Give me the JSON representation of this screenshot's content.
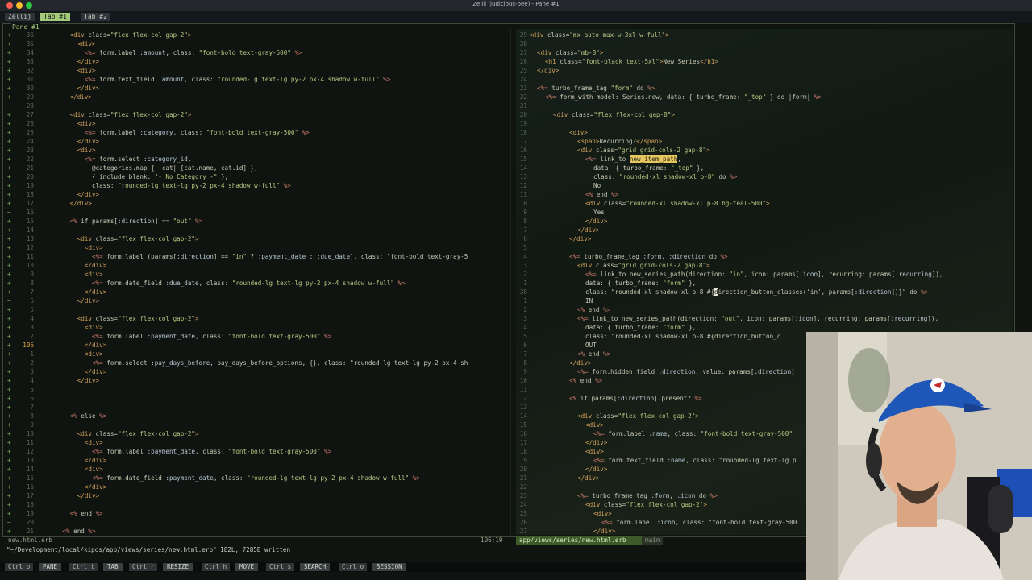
{
  "window": {
    "title": "Zellij (judicious-bee) - Pane #1"
  },
  "tabs": {
    "app": "Zellij",
    "tab1": "Tab #1",
    "tab2": "Tab #2"
  },
  "pane": {
    "title": "Pane #1"
  },
  "left": {
    "gutter_marks": [
      "+",
      "+",
      "+",
      "+",
      "+",
      "+",
      "+",
      "+",
      "~",
      "+",
      "+",
      "+",
      "+",
      "+",
      "+",
      "+",
      "+",
      "+",
      "+",
      "+",
      "~",
      "+",
      "+",
      "+",
      "+",
      "+",
      "+",
      "+",
      "+",
      "+",
      "~",
      "+",
      "+",
      "+",
      "+",
      "+",
      "+",
      "+",
      "+",
      "+",
      "+",
      "+",
      "+",
      "+",
      "+",
      "+",
      "+",
      "+",
      "+",
      "+",
      "+",
      "+",
      "+",
      "+",
      "+",
      "~",
      "+"
    ],
    "line_numbers": [
      "36",
      "35",
      "34",
      "33",
      "32",
      "31",
      "30",
      "29",
      "28",
      "27",
      "26",
      "25",
      "24",
      "23",
      "22",
      "21",
      "20",
      "19",
      "18",
      "17",
      "16",
      "15",
      "14",
      "13",
      "12",
      "11",
      "10",
      "9",
      "8",
      "7",
      "6",
      "5",
      "4",
      "3",
      "2",
      "106",
      "1",
      "2",
      "3",
      "4",
      "5",
      "6",
      "7",
      "8",
      "9",
      "10",
      "11",
      "12",
      "13",
      "14",
      "15",
      "16",
      "17",
      "18",
      "19",
      "20",
      "21"
    ],
    "lines": [
      {
        "indent": 8,
        "text": "<div class=\"flex flex-col gap-2\">"
      },
      {
        "indent": 10,
        "text": "<div>"
      },
      {
        "indent": 12,
        "text": "<%= form.label :amount, class: \"font-bold text-gray-500\" %>"
      },
      {
        "indent": 10,
        "text": "</div>"
      },
      {
        "indent": 10,
        "text": "<div>"
      },
      {
        "indent": 12,
        "text": "<%= form.text_field :amount, class: \"rounded-lg text-lg py-2 px-4 shadow w-full\" %>"
      },
      {
        "indent": 10,
        "text": "</div>"
      },
      {
        "indent": 8,
        "text": "</div>"
      },
      {
        "indent": 0,
        "text": ""
      },
      {
        "indent": 8,
        "text": "<div class=\"flex flex-col gap-2\">"
      },
      {
        "indent": 10,
        "text": "<div>"
      },
      {
        "indent": 12,
        "text": "<%= form.label :category, class: \"font-bold text-gray-500\" %>"
      },
      {
        "indent": 10,
        "text": "</div>"
      },
      {
        "indent": 10,
        "text": "<div>"
      },
      {
        "indent": 12,
        "text": "<%= form.select :category_id,"
      },
      {
        "indent": 14,
        "text": "@categories.map { |cat| [cat.name, cat.id] },"
      },
      {
        "indent": 14,
        "text": "{ include_blank: \"- No Category -\" },"
      },
      {
        "indent": 14,
        "text": "class: \"rounded-lg text-lg py-2 px-4 shadow w-full\" %>"
      },
      {
        "indent": 10,
        "text": "</div>"
      },
      {
        "indent": 8,
        "text": "</div>"
      },
      {
        "indent": 0,
        "text": ""
      },
      {
        "indent": 8,
        "text": "<% if params[:direction] == \"out\" %>"
      },
      {
        "indent": 0,
        "text": ""
      },
      {
        "indent": 10,
        "text": "<div class=\"flex flex-col gap-2\">"
      },
      {
        "indent": 12,
        "text": "<div>"
      },
      {
        "indent": 14,
        "text": "<%= form.label (params[:direction] == \"in\" ? :payment_date : :due_date), class: \"font-bold text-gray-5"
      },
      {
        "indent": 12,
        "text": "</div>"
      },
      {
        "indent": 12,
        "text": "<div>"
      },
      {
        "indent": 14,
        "text": "<%= form.date_field :due_date, class: \"rounded-lg text-lg py-2 px-4 shadow w-full\" %>"
      },
      {
        "indent": 12,
        "text": "</div>"
      },
      {
        "indent": 10,
        "text": "</div>"
      },
      {
        "indent": 0,
        "text": ""
      },
      {
        "indent": 10,
        "text": "<div class=\"flex flex-col gap-2\">"
      },
      {
        "indent": 12,
        "text": "<div>"
      },
      {
        "indent": 14,
        "text": "<%= form.label :payment_date, class: \"font-bold text-gray-500\" %>"
      },
      {
        "indent": 12,
        "text": "</div>"
      },
      {
        "indent": 12,
        "text": "<div>"
      },
      {
        "indent": 14,
        "text": "<%= form.select :pay_days_before, pay_days_before_options, {}, class: \"rounded-lg text-lg py-2 px-4 sh"
      },
      {
        "indent": 12,
        "text": "</div>"
      },
      {
        "indent": 10,
        "text": "</div>"
      },
      {
        "indent": 0,
        "text": ""
      },
      {
        "indent": 0,
        "text": ""
      },
      {
        "indent": 0,
        "text": ""
      },
      {
        "indent": 8,
        "text": "<% else %>"
      },
      {
        "indent": 0,
        "text": ""
      },
      {
        "indent": 10,
        "text": "<div class=\"flex flex-col gap-2\">"
      },
      {
        "indent": 12,
        "text": "<div>"
      },
      {
        "indent": 14,
        "text": "<%= form.label :payment_date, class: \"font-bold text-gray-500\" %>"
      },
      {
        "indent": 12,
        "text": "</div>"
      },
      {
        "indent": 12,
        "text": "<div>"
      },
      {
        "indent": 14,
        "text": "<%= form.date_field :payment_date, class: \"rounded-lg text-lg py-2 px-4 shadow w-full\" %>"
      },
      {
        "indent": 12,
        "text": "</div>"
      },
      {
        "indent": 10,
        "text": "</div>"
      },
      {
        "indent": 0,
        "text": ""
      },
      {
        "indent": 8,
        "text": "<% end %>"
      },
      {
        "indent": 0,
        "text": ""
      },
      {
        "indent": 6,
        "text": "<% end %>"
      }
    ]
  },
  "right": {
    "line_numbers": [
      "29",
      "28",
      "27",
      "26",
      "25",
      "24",
      "23",
      "22",
      "21",
      "20",
      "19",
      "18",
      "17",
      "16",
      "15",
      "14",
      "13",
      "12",
      "11",
      "10",
      "9",
      "8",
      "7",
      "6",
      "5",
      "4",
      "3",
      "2",
      "1",
      "38",
      "1",
      "2",
      "3",
      "4",
      "5",
      "6",
      "7",
      "8",
      "9",
      "10",
      "11",
      "12",
      "13",
      "14",
      "15",
      "16",
      "17",
      "18",
      "19",
      "20",
      "21",
      "22",
      "23",
      "24",
      "25",
      "26",
      "27"
    ],
    "lines": [
      {
        "indent": 0,
        "text": "<div class=\"mx-auto max-w-3xl w-full\">"
      },
      {
        "indent": 0,
        "text": ""
      },
      {
        "indent": 1,
        "text": "<div class=\"mb-8\">"
      },
      {
        "indent": 2,
        "text": "<h1 class=\"font-black text-5xl\">New Series</h1>"
      },
      {
        "indent": 1,
        "text": "</div>"
      },
      {
        "indent": 0,
        "text": ""
      },
      {
        "indent": 1,
        "text": "<%= turbo_frame_tag \"form\" do %>"
      },
      {
        "indent": 2,
        "text": "<%= form_with model: Series.new, data: { turbo_frame: \"_top\" } do |form| %>"
      },
      {
        "indent": 0,
        "text": ""
      },
      {
        "indent": 3,
        "text": "<div class=\"flex flex-col gap-8\">"
      },
      {
        "indent": 0,
        "text": ""
      },
      {
        "indent": 5,
        "text": "<div>"
      },
      {
        "indent": 6,
        "text": "<span>Recurring?</span>"
      },
      {
        "indent": 6,
        "text": "<div class=\"grid grid-cols-2 gap-8\">"
      },
      {
        "indent": 7,
        "text": "<%= link_to ",
        "hl": "new_item_path",
        "after": ","
      },
      {
        "indent": 8,
        "text": "data: { turbo_frame: \"_top\" },"
      },
      {
        "indent": 8,
        "text": "class: \"rounded-xl shadow-xl p-8\" do %>"
      },
      {
        "indent": 8,
        "text": "No"
      },
      {
        "indent": 7,
        "text": "<% end %>"
      },
      {
        "indent": 7,
        "text": "<div class=\"rounded-xl shadow-xl p-8 bg-teal-500\">"
      },
      {
        "indent": 8,
        "text": "Yes"
      },
      {
        "indent": 7,
        "text": "</div>"
      },
      {
        "indent": 6,
        "text": "</div>"
      },
      {
        "indent": 5,
        "text": "</div>"
      },
      {
        "indent": 0,
        "text": ""
      },
      {
        "indent": 5,
        "text": "<%= turbo_frame_tag :form, :direction do %>"
      },
      {
        "indent": 6,
        "text": "<div class=\"grid grid-cols-2 gap-8\">"
      },
      {
        "indent": 7,
        "text": "<%= link_to new_series_path(direction: \"in\", icon: params[:icon], recurring: params[:recurring]),"
      },
      {
        "indent": 7,
        "text": "data: { turbo_frame: \"form\" },"
      },
      {
        "indent": 7,
        "text": "class: \"rounded-xl shadow-xl p-8 #{",
        "cursor": "d",
        "after": "irection_button_classes('in', params[:direction])}\" do %>"
      },
      {
        "indent": 7,
        "text": "IN"
      },
      {
        "indent": 6,
        "text": "<% end %>"
      },
      {
        "indent": 6,
        "text": "<%= link_to new_series_path(direction: \"out\", icon: params[:icon], recurring: params[:recurring]),"
      },
      {
        "indent": 7,
        "text": "data: { turbo_frame: \"form\" },"
      },
      {
        "indent": 7,
        "text": "class: \"rounded-xl shadow-xl p-8 #{direction_button_c"
      },
      {
        "indent": 7,
        "text": "OUT"
      },
      {
        "indent": 6,
        "text": "<% end %>"
      },
      {
        "indent": 5,
        "text": "</div>"
      },
      {
        "indent": 6,
        "text": "<%= form.hidden_field :direction, value: params[:direction]"
      },
      {
        "indent": 5,
        "text": "<% end %>"
      },
      {
        "indent": 0,
        "text": ""
      },
      {
        "indent": 5,
        "text": "<% if params[:direction].present? %>"
      },
      {
        "indent": 0,
        "text": ""
      },
      {
        "indent": 6,
        "text": "<div class=\"flex flex-col gap-2\">"
      },
      {
        "indent": 7,
        "text": "<div>"
      },
      {
        "indent": 8,
        "text": "<%= form.label :name, class: \"font-bold text-gray-500\""
      },
      {
        "indent": 7,
        "text": "</div>"
      },
      {
        "indent": 7,
        "text": "<div>"
      },
      {
        "indent": 8,
        "text": "<%= form.text_field :name, class: \"rounded-lg text-lg p"
      },
      {
        "indent": 7,
        "text": "</div>"
      },
      {
        "indent": 6,
        "text": "</div>"
      },
      {
        "indent": 0,
        "text": ""
      },
      {
        "indent": 6,
        "text": "<%= turbo_frame_tag :form, :icon do %>"
      },
      {
        "indent": 7,
        "text": "<div class=\"flex flex-col gap-2\">"
      },
      {
        "indent": 8,
        "text": "<div>"
      },
      {
        "indent": 9,
        "text": "<%= form.label :icon, class: \"font-bold text-gray-500"
      },
      {
        "indent": 8,
        "text": "</div>"
      }
    ]
  },
  "status": {
    "left_file": "new.html.erb",
    "position": "106:19",
    "file_path": "app/views/series/new.html.erb",
    "branch": "main"
  },
  "cmdline": "\"~/Development/local/kipos/app/views/series/new.html.erb\" 182L, 7285B written",
  "keybar": [
    {
      "key": "Ctrl p",
      "label": "PANE"
    },
    {
      "key": "Ctrl t",
      "label": "TAB"
    },
    {
      "key": "Ctrl r",
      "label": "RESIZE"
    },
    {
      "key": "Ctrl h",
      "label": "MOVE"
    },
    {
      "key": "Ctrl s",
      "label": "SEARCH"
    },
    {
      "key": "Ctrl o",
      "label": "SESSION"
    }
  ],
  "colors": {
    "tag": "#d0a05a",
    "string": "#b8c780",
    "erb": "#c9796a",
    "ruby": "#b6c7d2",
    "text": "#c8c8b4",
    "highlight_bg": "#e8c760",
    "tab_active": "#a3c97a"
  }
}
